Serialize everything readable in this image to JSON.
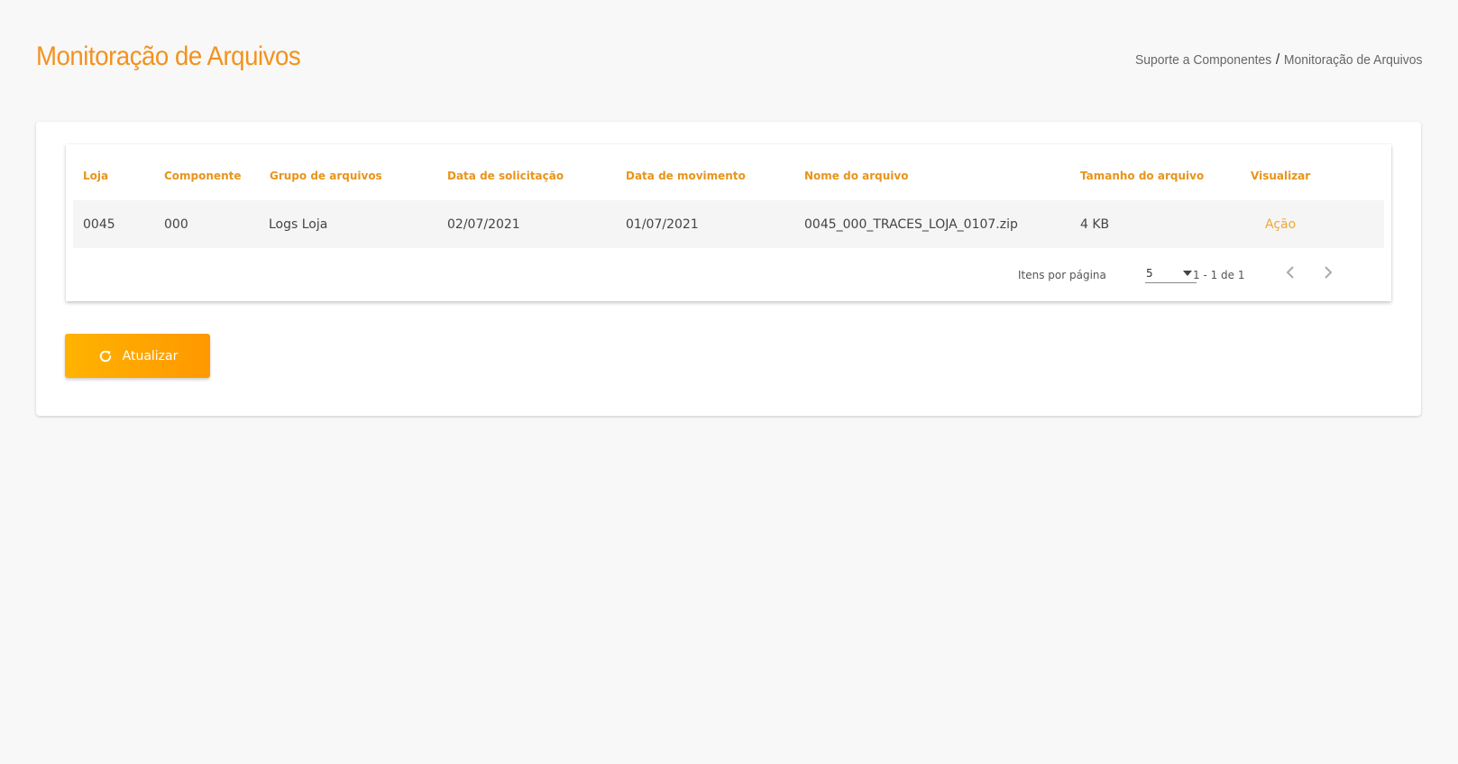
{
  "header": {
    "title": "Monitoração de Arquivos",
    "breadcrumb": {
      "parent": "Suporte a Componentes",
      "separator": "/",
      "current": "Monitoração de Arquivos"
    }
  },
  "table": {
    "columns": [
      "Loja",
      "Componente",
      "Grupo de arquivos",
      "Data de solicitação",
      "Data de movimento",
      "Nome do arquivo",
      "Tamanho do arquivo",
      "Visualizar"
    ],
    "rows": [
      [
        "0045",
        "000",
        "Logs Loja",
        "02/07/2021",
        "01/07/2021",
        "0045_000_TRACES_LOJA_0107.zip",
        "4 KB",
        "Ação"
      ]
    ]
  },
  "pagination": {
    "items_per_page_label": "Itens por página",
    "items_per_page_value": "5",
    "range_label": "1 - 1 de 1",
    "prev_icon": "chevron-left-icon",
    "next_icon": "chevron-right-icon"
  },
  "actions": {
    "refresh_label": "Atualizar",
    "refresh_icon": "refresh-icon"
  },
  "colors": {
    "accent": "#f2921d",
    "button_start": "#ffb300",
    "button_end": "#ff9800"
  }
}
